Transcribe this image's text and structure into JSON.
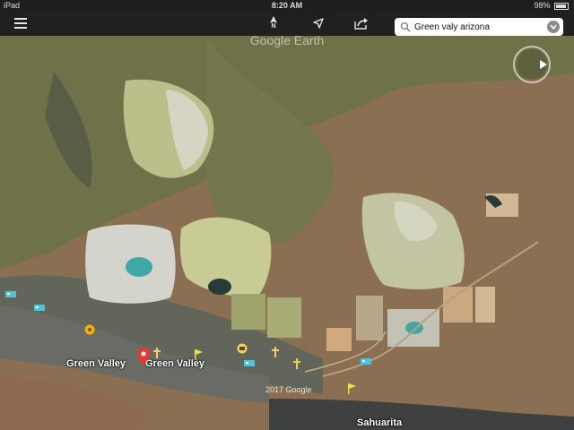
{
  "status_bar": {
    "device": "iPad",
    "time": "8:20 AM",
    "battery": "98%"
  },
  "toolbar": {
    "north_label": "N",
    "search_value": "Green valy arizona",
    "icons": [
      "menu-icon",
      "north-arrow-icon",
      "location-arrow-icon",
      "share-icon",
      "search-icon",
      "clear-search-icon"
    ]
  },
  "map": {
    "watermark": "Google Earth",
    "copyright": "2017 Google",
    "places": [
      "Green Valley",
      "Green Valley",
      "Sahuarita"
    ],
    "colors": {
      "terrain": "#8a6f52",
      "tailings": "#d8d4c4",
      "water": "#3fa7a6",
      "urban": "#6b6b66"
    }
  }
}
